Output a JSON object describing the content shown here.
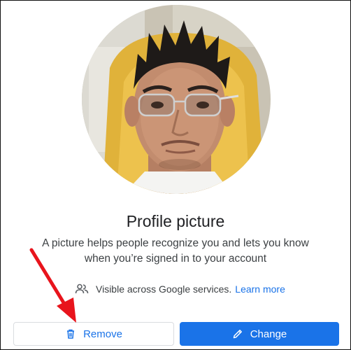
{
  "dialog": {
    "title": "Profile picture",
    "description": "A picture helps people recognize you and lets you know when you’re signed in to your account",
    "visibility_text": "Visible across Google services.",
    "learn_more_label": "Learn more",
    "visibility_icon": "people-icon",
    "avatar_icon": "profile-photo"
  },
  "buttons": {
    "remove_label": "Remove",
    "remove_icon": "trash-icon",
    "change_label": "Change",
    "change_icon": "pencil-icon"
  },
  "colors": {
    "accent": "#1a73e8",
    "annotation_arrow": "#e8141c",
    "text_primary": "#202124",
    "text_secondary": "#3c4043"
  }
}
